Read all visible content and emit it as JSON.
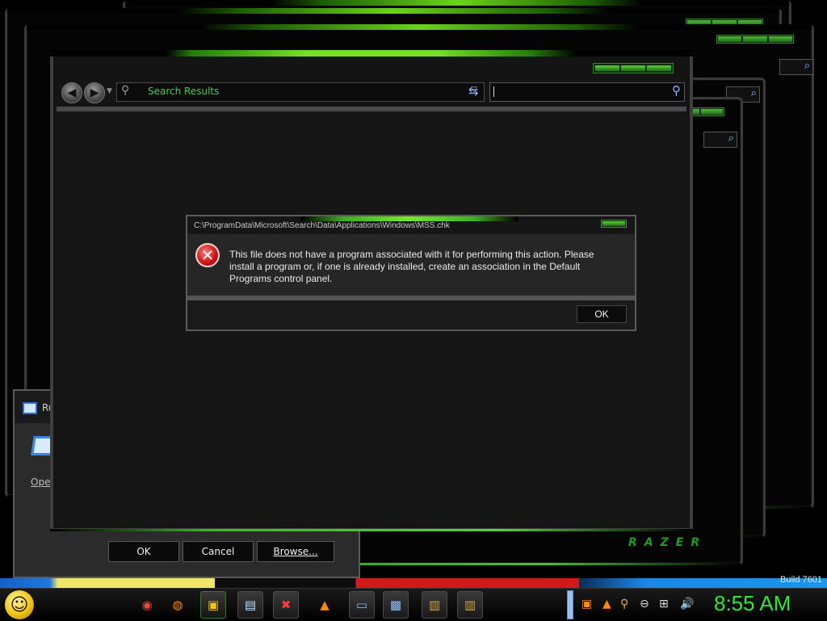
{
  "error_dialog": {
    "title": "C:\\ProgramData\\Microsoft\\Search\\Data\\Applications\\Windows\\MSS.chk",
    "message": "This file does not have a program associated with it for performing this action. Please install a program or, if one is already installed, create an association in the Default Programs control panel.",
    "ok_label": "OK",
    "icon": "error-icon"
  },
  "explorer": {
    "address": "Search Results",
    "back_icon": "back-arrow-icon",
    "forward_icon": "forward-arrow-icon",
    "search_value": ""
  },
  "run_dialog": {
    "title": "Ru",
    "open_label": "Open",
    "ok_label": "OK",
    "cancel_label": "Cancel",
    "browse_label": "Browse..."
  },
  "desktop": {
    "build_text": "Build 7601",
    "brand_text": "RAZER"
  },
  "taskbar": {
    "start_icon": "smiley-start-orb",
    "items": [
      {
        "name": "chrome-icon",
        "glyph": "◉",
        "color": "#e84a3a",
        "state": "pinned"
      },
      {
        "name": "firefox-icon",
        "glyph": "◍",
        "color": "#ff8a1a",
        "state": "pinned"
      },
      {
        "name": "folder-icon",
        "glyph": "▣",
        "color": "#f0c814",
        "state": "active"
      },
      {
        "name": "notepad-icon",
        "glyph": "▤",
        "color": "#bfe0ff",
        "state": "running"
      },
      {
        "name": "error-app-icon",
        "glyph": "✖",
        "color": "#ff3b3b",
        "state": "running"
      },
      {
        "name": "vlc-icon",
        "glyph": "▲",
        "color": "#ff8a00",
        "state": "pinned"
      },
      {
        "name": "run-icon",
        "glyph": "▭",
        "color": "#7fb4ff",
        "state": "running"
      },
      {
        "name": "screen-icon",
        "glyph": "▩",
        "color": "#8ec3ff",
        "state": "running"
      },
      {
        "name": "archive-icon",
        "glyph": "▥",
        "color": "#d9a441",
        "state": "running"
      },
      {
        "name": "archive2-icon",
        "glyph": "▥",
        "color": "#d9a441",
        "state": "running"
      }
    ],
    "tray": [
      {
        "name": "tray-app-icon",
        "glyph": "▣",
        "color": "#ff8a1a"
      },
      {
        "name": "vlc-tray-icon",
        "glyph": "▲",
        "color": "#ff8a00"
      },
      {
        "name": "search-tray-icon",
        "glyph": "⚲",
        "color": "#ffa640"
      },
      {
        "name": "minus-tray-icon",
        "glyph": "⊖",
        "color": "#dddddd"
      },
      {
        "name": "network-icon",
        "glyph": "⊞",
        "color": "#dddddd"
      },
      {
        "name": "volume-icon",
        "glyph": "🔊",
        "color": "#dddddd"
      }
    ],
    "clock": "8:55 AM"
  },
  "colors": {
    "accent_green": "#37d44a",
    "clock_green": "#2fe63a",
    "error_red": "#d01818"
  }
}
